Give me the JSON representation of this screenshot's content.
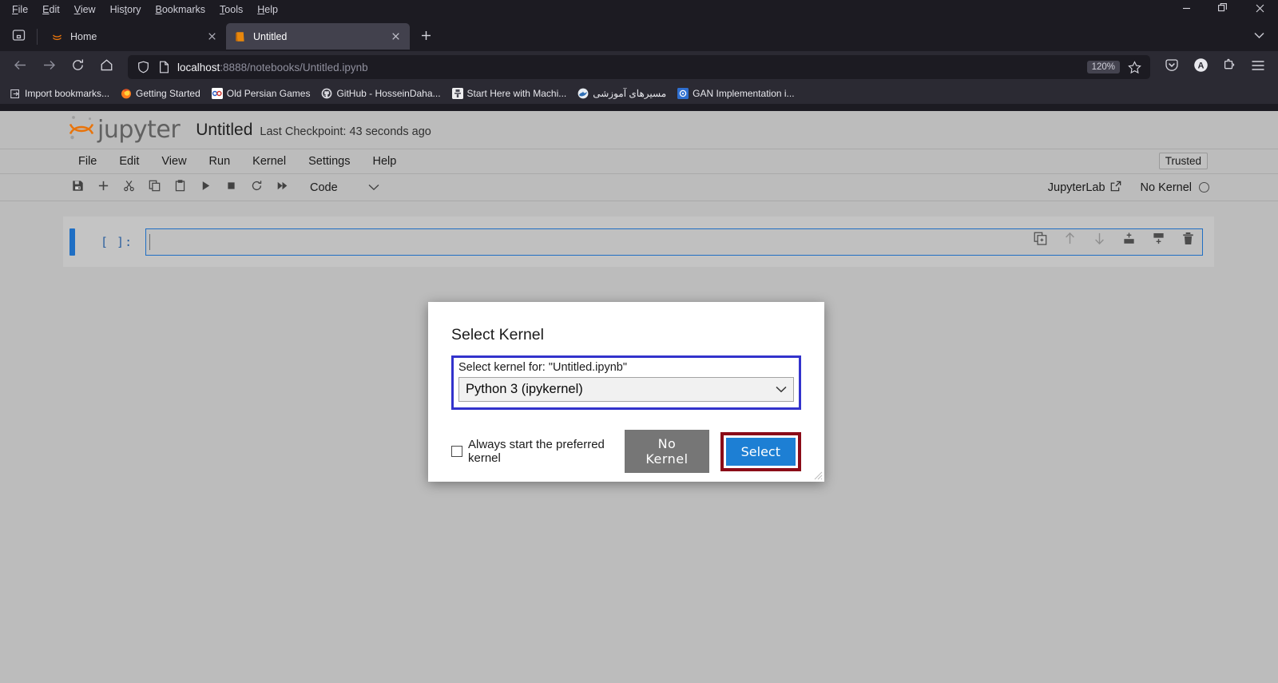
{
  "browser": {
    "menubar": [
      {
        "pre": "",
        "key": "F",
        "post": "ile"
      },
      {
        "pre": "",
        "key": "E",
        "post": "dit"
      },
      {
        "pre": "",
        "key": "V",
        "post": "iew"
      },
      {
        "pre": "His",
        "key": "t",
        "post": "ory"
      },
      {
        "pre": "",
        "key": "B",
        "post": "ookmarks"
      },
      {
        "pre": "",
        "key": "T",
        "post": "ools"
      },
      {
        "pre": "",
        "key": "H",
        "post": "elp"
      }
    ],
    "window_controls": {
      "minimize": "minimize-icon",
      "restore": "restore-icon",
      "close": "close-icon"
    },
    "tabs": [
      {
        "title": "Home",
        "icon": "jupyter-logo-icon",
        "active": false
      },
      {
        "title": "Untitled",
        "icon": "notebook-icon",
        "active": true
      }
    ],
    "new_tab_label": "+",
    "url": {
      "host": "localhost",
      "rest": ":8888/notebooks/Untitled.ipynb"
    },
    "zoom_level": "120%",
    "toolbar_icons": [
      "pocket-icon",
      "account-icon",
      "extensions-icon",
      "app-menu-icon"
    ],
    "bookmarks": [
      {
        "label": "Import bookmarks...",
        "icon": "import-icon",
        "color": "#cfcfd8"
      },
      {
        "label": "Getting Started",
        "icon": "firefox-icon",
        "color": "#e66000"
      },
      {
        "label": "Old Persian Games",
        "icon": "site-icon",
        "color": "#ffffff"
      },
      {
        "label": "GitHub - HosseinDaha...",
        "icon": "github-icon",
        "color": "#d8d8de"
      },
      {
        "label": "Start Here with Machi...",
        "icon": "site-icon",
        "color": "#dddddd"
      },
      {
        "label": "مسیرهای آموزشی",
        "icon": "site-icon",
        "color": "#3b7dc4"
      },
      {
        "label": "GAN Implementation i...",
        "icon": "site-icon",
        "color": "#2f6fd0"
      }
    ]
  },
  "jupyter": {
    "logo_text": "jupyter",
    "notebook_title": "Untitled",
    "checkpoint": "Last Checkpoint: 43 seconds ago",
    "trusted_badge": "Trusted",
    "menus": [
      "File",
      "Edit",
      "View",
      "Run",
      "Kernel",
      "Settings",
      "Help"
    ],
    "toolbar": {
      "icons": [
        "save-icon",
        "add-cell-icon",
        "cut-icon",
        "copy-icon",
        "paste-icon",
        "run-icon",
        "stop-icon",
        "restart-icon",
        "run-all-icon"
      ],
      "cell_type": "Code"
    },
    "jupyterlab_link": "JupyterLab",
    "kernel_status": "No Kernel",
    "cell": {
      "prompt": "[ ]:",
      "code": "",
      "actions": [
        "duplicate-cell-icon",
        "move-cell-up-icon",
        "move-cell-down-icon",
        "insert-cell-above-icon",
        "insert-cell-below-icon",
        "delete-cell-icon"
      ]
    }
  },
  "dialog": {
    "title": "Select Kernel",
    "label": "Select kernel for: \"Untitled.ipynb\"",
    "selected_kernel": "Python 3 (ipykernel)",
    "kernel_options": [
      "Python 3 (ipykernel)",
      "No Kernel"
    ],
    "checkbox_label": "Always start the preferred kernel",
    "checkbox_checked": false,
    "no_kernel_button": "No Kernel",
    "select_button": "Select",
    "highlight_colors": {
      "focus_outline": "#3333cc",
      "select_outline": "#8b0b18",
      "select_button_bg": "#1d7fd4",
      "no_kernel_button_bg": "#767676"
    }
  }
}
